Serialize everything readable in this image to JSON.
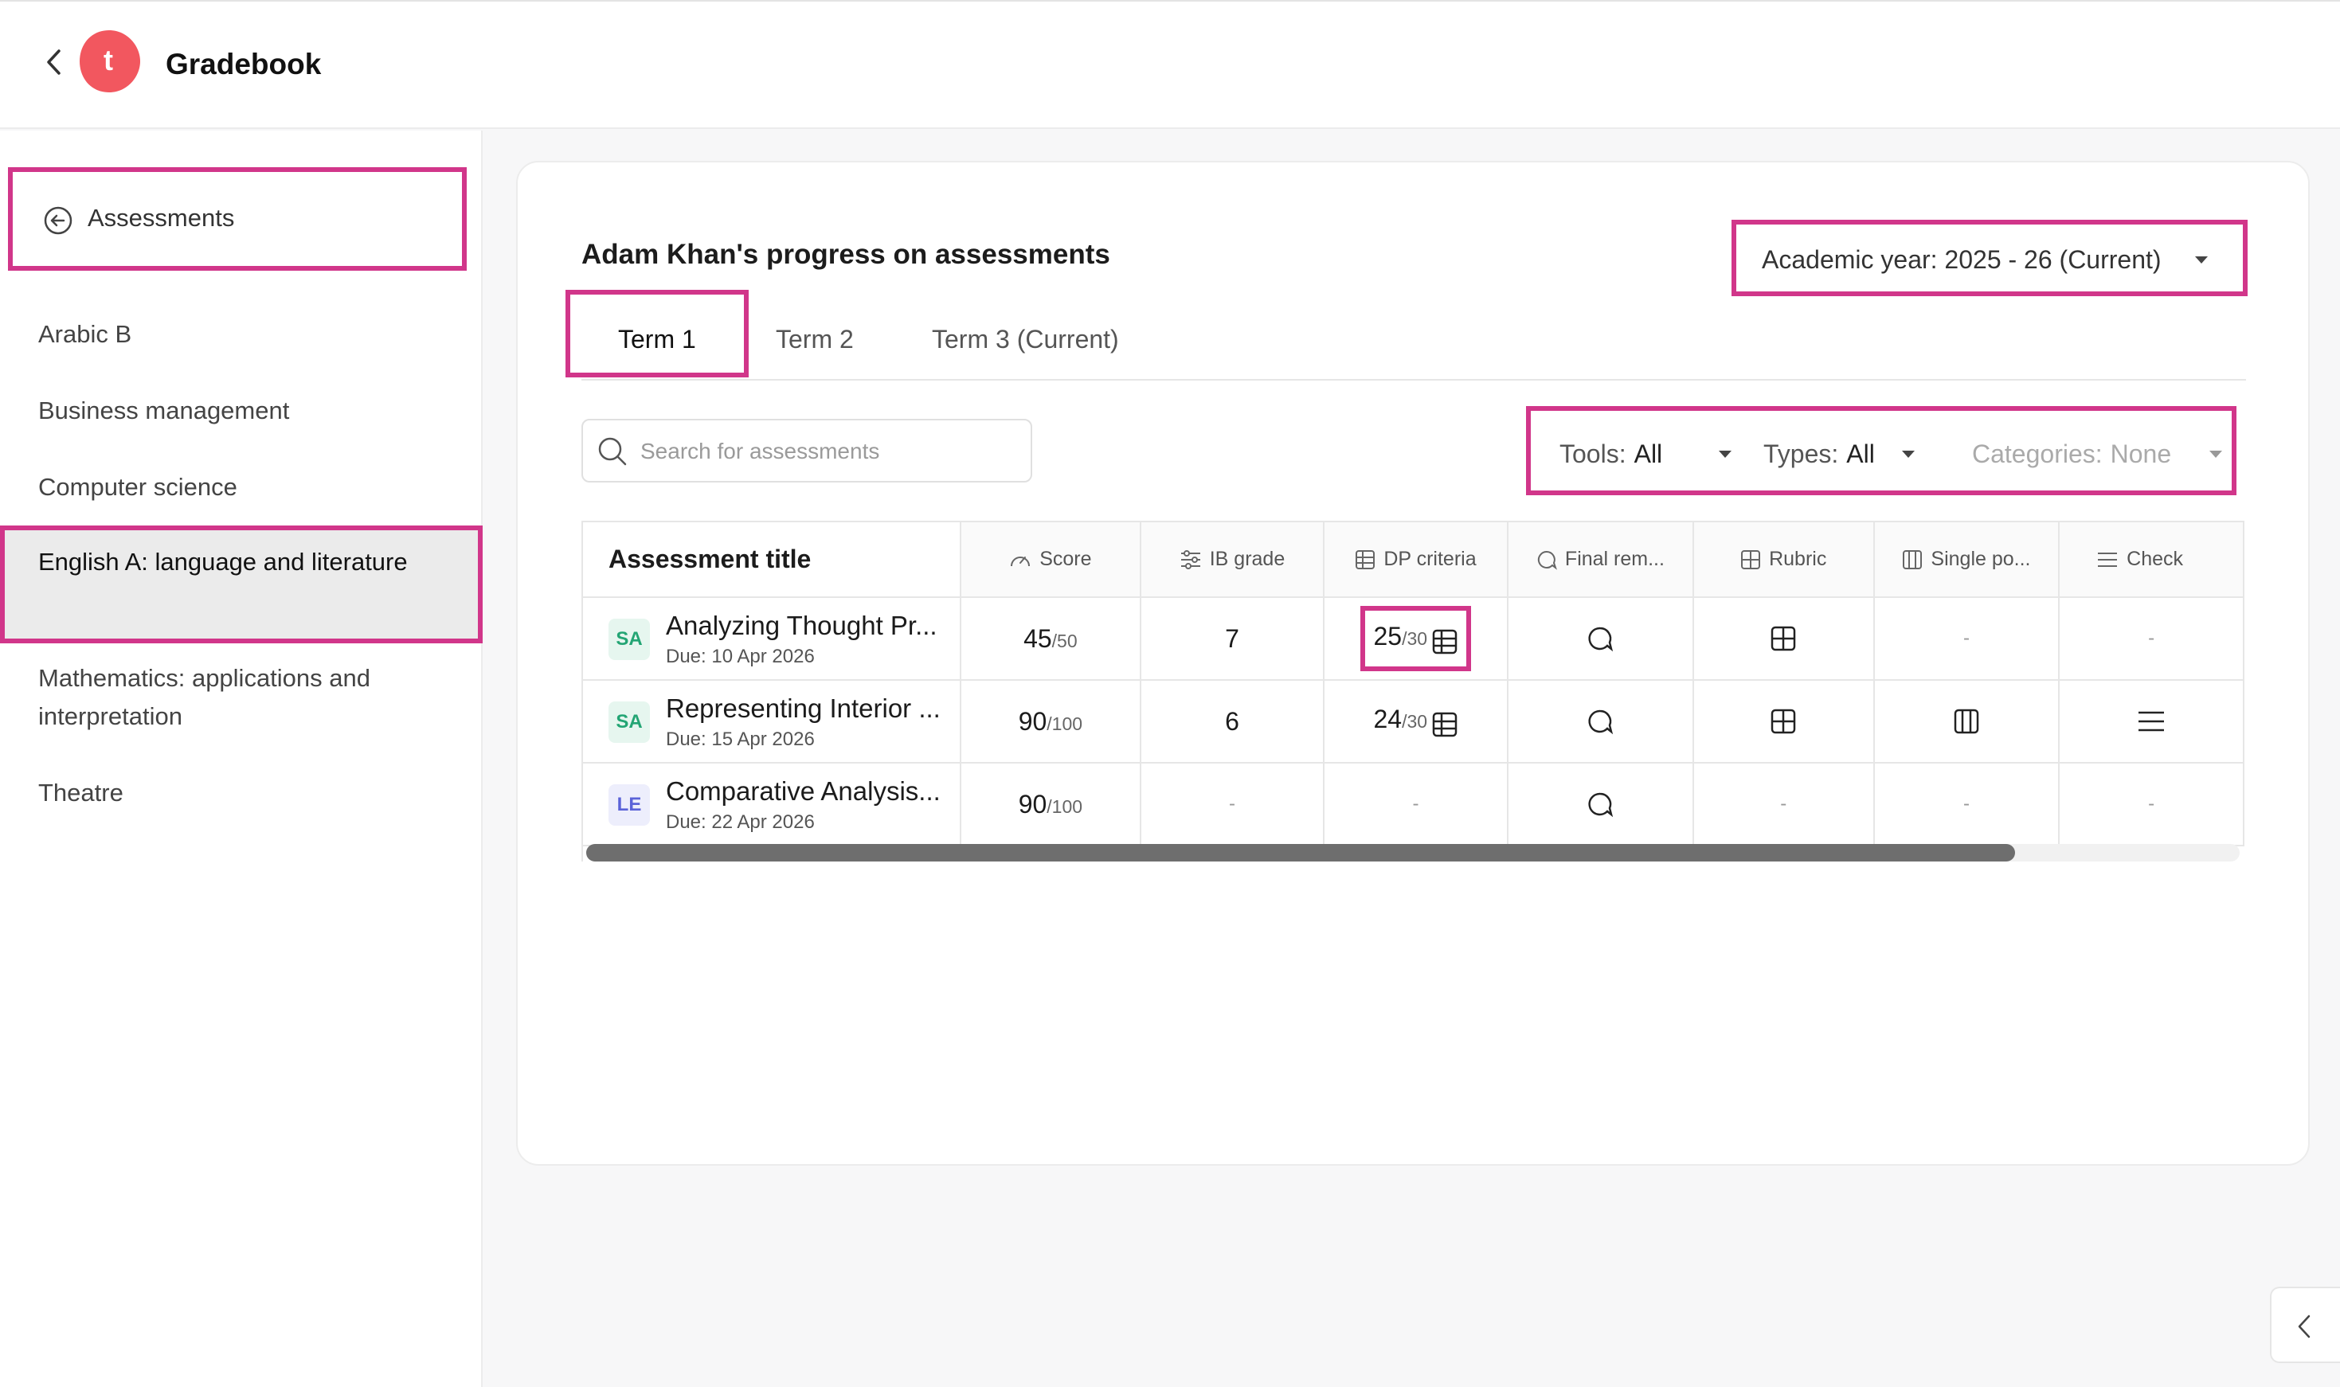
{
  "header": {
    "title": "Gradebook",
    "logo_letter": "t",
    "brand_color": "#f2575f"
  },
  "sidebar": {
    "back_label": "Assessments",
    "items": [
      {
        "label": "Arabic B"
      },
      {
        "label": "Business management"
      },
      {
        "label": "Computer science"
      },
      {
        "label": "English A: language and literature",
        "active": true
      },
      {
        "label": "Mathematics: applications and interpretation"
      },
      {
        "label": "Theatre"
      }
    ]
  },
  "main": {
    "title": "Adam Khan's progress on assessments",
    "academic_year": "Academic year: 2025 - 26 (Current)",
    "tabs": [
      {
        "label": "Term 1",
        "active": true
      },
      {
        "label": "Term 2"
      },
      {
        "label": "Term 3 (Current)"
      }
    ],
    "search_placeholder": "Search for assessments",
    "filters": {
      "tools_label": "Tools:",
      "tools_value": "All",
      "types_label": "Types:",
      "types_value": "All",
      "categories_label": "Categories:",
      "categories_value": "None"
    },
    "table": {
      "columns": [
        "Assessment title",
        "Score",
        "IB grade",
        "DP criteria",
        "Final rem...",
        "Rubric",
        "Single po...",
        "Check"
      ],
      "rows": [
        {
          "badge": "SA",
          "title": "Analyzing Thought Pr...",
          "due": "Due: 10 Apr 2026",
          "score": "45",
          "score_total": "/50",
          "ib_grade": "7",
          "dp": "25",
          "dp_total": "/30",
          "final": "comment-icon",
          "rubric": "grid-icon",
          "single": "-",
          "check": "-"
        },
        {
          "badge": "SA",
          "title": "Representing Interior ...",
          "due": "Due: 15 Apr 2026",
          "score": "90",
          "score_total": "/100",
          "ib_grade": "6",
          "dp": "24",
          "dp_total": "/30",
          "final": "comment-icon",
          "rubric": "grid-icon",
          "single": "columns-icon",
          "check": "list-icon"
        },
        {
          "badge": "LE",
          "title": "Comparative Analysis...",
          "due": "Due: 22 Apr 2026",
          "score": "90",
          "score_total": "/100",
          "ib_grade": "-",
          "dp": "-",
          "final": "comment-icon",
          "rubric": "-",
          "single": "-",
          "check": "-"
        }
      ]
    }
  },
  "colors": {
    "highlight": "#d1368a",
    "sa_badge": "#23a574",
    "le_badge": "#5a62d8"
  }
}
